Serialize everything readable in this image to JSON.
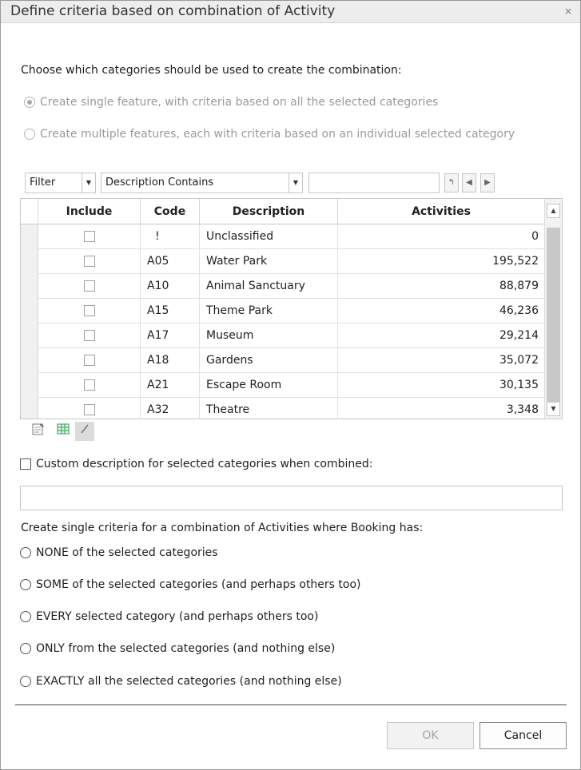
{
  "dialog": {
    "title": "Define criteria based on combination of Activity",
    "close_glyph": "×"
  },
  "categories_section": {
    "prompt": "Choose which categories should be used to create the combination:",
    "options": [
      {
        "label": "Create single feature, with criteria based on all the selected categories",
        "checked": true,
        "enabled": false
      },
      {
        "label": "Create multiple features, each with criteria based on an individual selected category",
        "checked": false,
        "enabled": false
      }
    ]
  },
  "filter_bar": {
    "filter_mode": "Filter",
    "filter_field": "Description Contains",
    "filter_value": "",
    "icons": [
      "return-icon",
      "nav-prev-icon",
      "nav-next-icon"
    ]
  },
  "grid": {
    "columns": [
      "Include",
      "Code",
      "Description",
      "Activities"
    ],
    "rows": [
      {
        "include": false,
        "code": "!",
        "description": "Unclassified",
        "activities": "0"
      },
      {
        "include": false,
        "code": "A05",
        "description": "Water Park",
        "activities": "195,522"
      },
      {
        "include": false,
        "code": "A10",
        "description": "Animal Sanctuary",
        "activities": "88,879"
      },
      {
        "include": false,
        "code": "A15",
        "description": "Theme Park",
        "activities": "46,236"
      },
      {
        "include": false,
        "code": "A17",
        "description": "Museum",
        "activities": "29,214"
      },
      {
        "include": false,
        "code": "A18",
        "description": "Gardens",
        "activities": "35,072"
      },
      {
        "include": false,
        "code": "A21",
        "description": "Escape Room",
        "activities": "30,135"
      },
      {
        "include": false,
        "code": "A32",
        "description": "Theatre",
        "activities": "3,348"
      }
    ],
    "toolbar_icons": [
      "properties-icon",
      "grid-view-icon",
      "edit-pencil-icon"
    ]
  },
  "custom_description": {
    "label": "Custom description for selected categories when combined:",
    "checked": false,
    "value": ""
  },
  "combination_section": {
    "prompt": "Create single criteria for a combination of Activities where Booking has:",
    "options": [
      {
        "label": "NONE of the selected categories",
        "checked": false
      },
      {
        "label": "SOME of the selected categories (and perhaps others too)",
        "checked": false
      },
      {
        "label": "EVERY selected category (and perhaps others too)",
        "checked": false
      },
      {
        "label": "ONLY from the selected categories (and nothing else)",
        "checked": false
      },
      {
        "label": "EXACTLY all the selected categories (and nothing else)",
        "checked": false
      }
    ]
  },
  "buttons": {
    "ok": "OK",
    "cancel": "Cancel"
  }
}
